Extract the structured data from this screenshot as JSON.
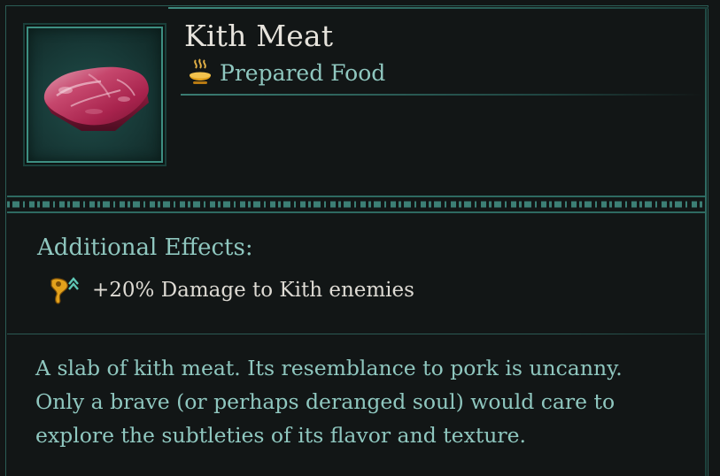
{
  "item": {
    "name": "Kith Meat",
    "category": "Prepared Food",
    "icon": "raw-meat-slab-icon",
    "category_icon": "steaming-dish-icon"
  },
  "effects": {
    "heading": "Additional Effects:",
    "items": [
      {
        "icon": "damage-up-icon",
        "text": "+20% Damage to Kith enemies"
      }
    ]
  },
  "description": {
    "lines": [
      "A slab of kith meat. Its resemblance to pork is uncanny.",
      "Only a brave (or perhaps deranged soul) would care to",
      "explore the subtleties of its flavor and texture."
    ]
  },
  "colors": {
    "background": "#121616",
    "accent_teal": "#3e8f82",
    "title_text": "#e6e3dc",
    "teal_text": "#8fc7bf",
    "effect_icon": "#e2a11c"
  }
}
